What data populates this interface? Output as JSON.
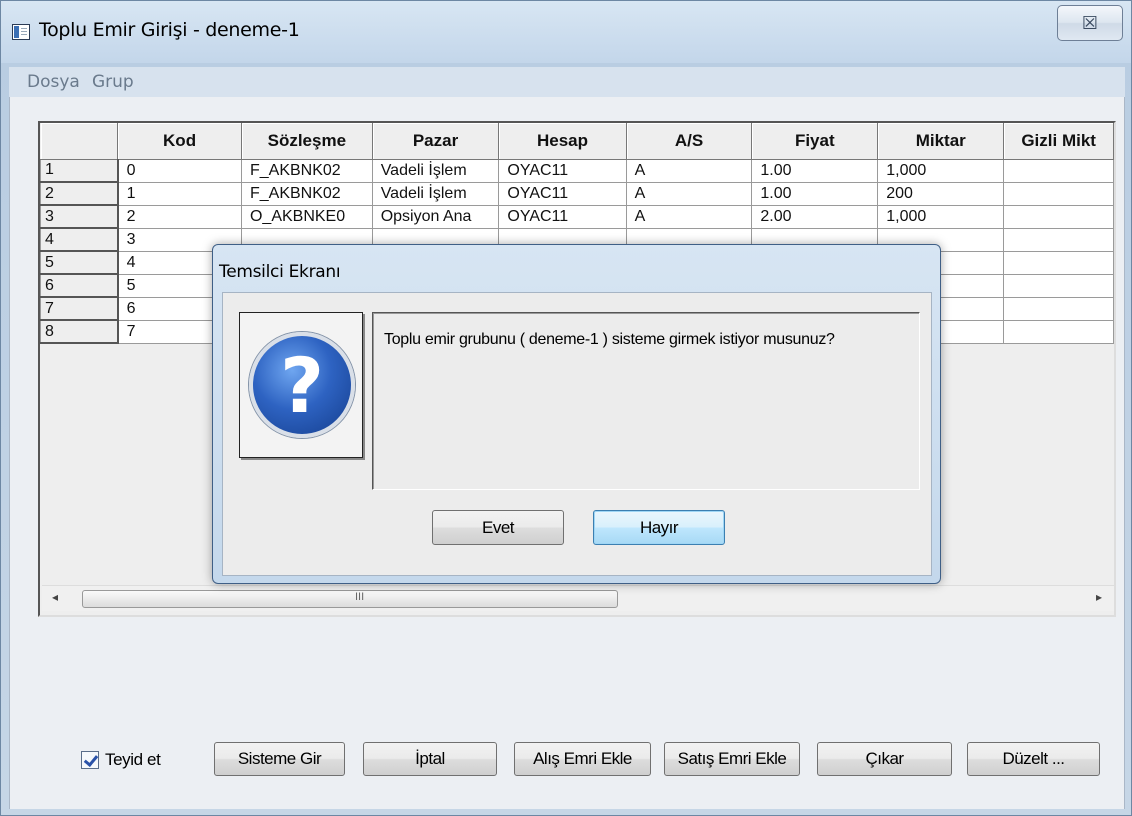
{
  "window": {
    "title": "Toplu Emir Girişi - deneme-1",
    "close_glyph": "☒"
  },
  "menu": [
    "Dosya",
    "Grup"
  ],
  "grid": {
    "columns": [
      "",
      "Kod",
      "Sözleşme",
      "Pazar",
      "Hesap",
      "A/S",
      "Fiyat",
      "Miktar",
      "Gizli Mikt"
    ],
    "rows": [
      [
        "1",
        "0",
        "F_AKBNK02",
        "Vadeli İşlem",
        "OYAC11",
        "A",
        "1.00",
        "1,000",
        ""
      ],
      [
        "2",
        "1",
        "F_AKBNK02",
        "Vadeli İşlem",
        "OYAC11",
        "A",
        "1.00",
        "200",
        ""
      ],
      [
        "3",
        "2",
        "O_AKBNKE0",
        "Opsiyon Ana",
        "OYAC11",
        "A",
        "2.00",
        "1,000",
        ""
      ],
      [
        "4",
        "3",
        "",
        "",
        "",
        "",
        "",
        "",
        ""
      ],
      [
        "5",
        "4",
        "",
        "",
        "",
        "",
        "",
        "",
        ""
      ],
      [
        "6",
        "5",
        "",
        "",
        "",
        "",
        "",
        "",
        ""
      ],
      [
        "7",
        "6",
        "",
        "",
        "",
        "",
        "",
        "",
        ""
      ],
      [
        "8",
        "7",
        "",
        "",
        "",
        "",
        "",
        "",
        ""
      ]
    ]
  },
  "scroll": {
    "left": "◂",
    "right": "▸",
    "grip": "III"
  },
  "bottom": {
    "confirm_label": "Teyid et",
    "confirm_checked": true,
    "buttons": {
      "submit": "Sisteme Gir",
      "cancel": "İptal",
      "add_buy": "Alış Emri Ekle",
      "add_sell": "Satış Emri Ekle",
      "remove": "Çıkar",
      "edit": "Düzelt ..."
    }
  },
  "dialog": {
    "title": "Temsilci Ekranı",
    "icon": "question-icon",
    "icon_glyph": "?",
    "message": "Toplu emir grubunu ( deneme-1 ) sisteme girmek istiyor musunuz?",
    "yes": "Evet",
    "no": "Hayır"
  }
}
